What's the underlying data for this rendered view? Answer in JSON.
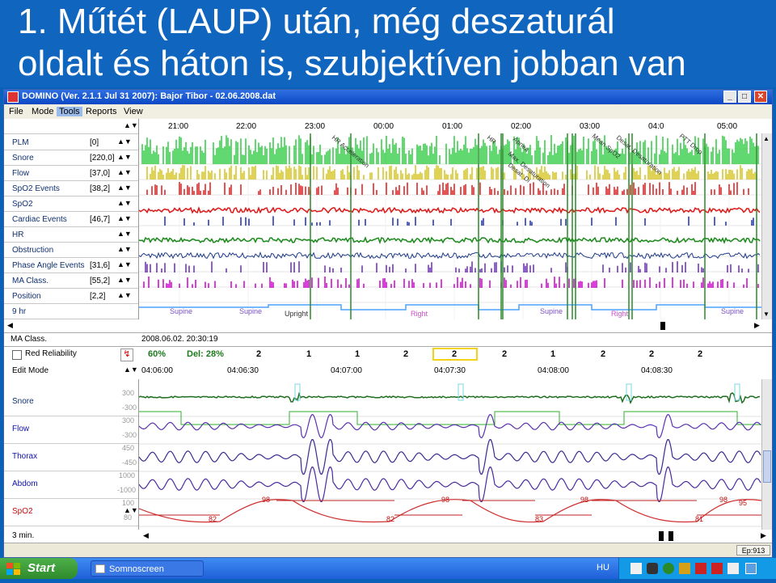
{
  "slide": {
    "title_line1": "1. Műtét (LAUP) után, még deszaturál",
    "title_line2": "oldalt és háton is, szubjektíven jobban van"
  },
  "window": {
    "title": "DOMINO (Ver. 2.1.1 Jul 31 2007): Bajor Tibor - 02.06.2008.dat",
    "buttons": {
      "minimize": "_",
      "maximize": "□",
      "close": "✕"
    }
  },
  "menu": [
    "File",
    "Mode",
    "Tools",
    "Reports",
    "View"
  ],
  "time_axis": [
    "21:00",
    "22:00",
    "23:00",
    "00:00",
    "01:00",
    "02:00",
    "03:00",
    "04:0",
    "05:00"
  ],
  "overview_channels": [
    {
      "name": "PLM",
      "value": "[0]"
    },
    {
      "name": "Snore",
      "value": "[220,0]"
    },
    {
      "name": "Flow",
      "value": "[37,0]"
    },
    {
      "name": "SpO2 Events",
      "value": "[38,2]"
    },
    {
      "name": "SpO2",
      "value": ""
    },
    {
      "name": "Cardiac Events",
      "value": "[46,7]"
    },
    {
      "name": "HR",
      "value": ""
    },
    {
      "name": "Obstruction",
      "value": ""
    },
    {
      "name": "Phase Angle Events",
      "value": "[31,6]"
    },
    {
      "name": "MA Class.",
      "value": "[55,2]"
    },
    {
      "name": "Position",
      "value": "[2,2]"
    }
  ],
  "overview_annotations": [
    "HR Acceleration",
    "HR",
    "Apnea",
    "Max. Desaturation",
    "Desat. Di",
    "Mean SpO2",
    "Desat. Desaturation",
    "PTT Drop"
  ],
  "positions": [
    "Supine",
    "Supine",
    "Upright",
    "Right",
    "Supine",
    "Right",
    "Supine"
  ],
  "overview_footer": "9 hr",
  "info_row": {
    "label": "MA Class.",
    "datetime": "2008.06.02. 20:30:19"
  },
  "control_row": {
    "checkbox_label": "Red Reliability",
    "percent": "60%",
    "del": "Del: 28%",
    "epoch_values": [
      "2",
      "1",
      "1",
      "2",
      "2",
      "2",
      "1",
      "2",
      "2",
      "2"
    ]
  },
  "edit_row": {
    "label": "Edit Mode",
    "times": [
      "04:06:00",
      "04:06:30",
      "04:07:00",
      "04:07:30",
      "04:08:00",
      "04:08:30"
    ]
  },
  "detail_channels": [
    {
      "name": "Snore",
      "scale_top": "300",
      "scale_bottom": "-300"
    },
    {
      "name": "Flow",
      "scale_top": "300",
      "scale_bottom": "-300"
    },
    {
      "name": "Thorax",
      "scale_top": "450",
      "scale_bottom": "-450"
    },
    {
      "name": "Abdom",
      "scale_top": "1000",
      "scale_bottom": "-1000"
    },
    {
      "name": "SpO2",
      "scale_top": "100",
      "scale_bottom": "80"
    }
  ],
  "detail_scale_extra": [
    "100",
    "-100",
    "300",
    "-300"
  ],
  "spo2_labels": [
    "98",
    "82",
    "98",
    "82",
    "98",
    "83",
    "98",
    "81",
    "95"
  ],
  "footer": {
    "span": "3 min.",
    "epoch": "Ep:913"
  },
  "taskbar": {
    "start": "Start",
    "task": "Somnoscreen",
    "lang": "HU"
  },
  "colors": {
    "snore": "#2ecc40",
    "flow": "#d4c31c",
    "spo2_events": "#e01818",
    "hr": "#1a8a1a",
    "obstruction": "#1e3a8a",
    "ma_class": "#cc00cc",
    "position": "#4aa0ff"
  }
}
